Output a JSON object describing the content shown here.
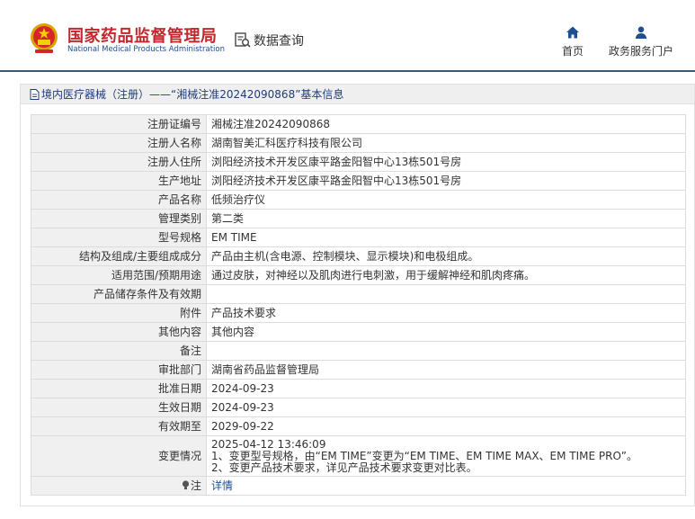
{
  "header": {
    "brand_cn": "国家药品监督管理局",
    "brand_en": "National Medical Products Administration",
    "query_label": "数据查询",
    "nav": [
      {
        "label": "首页"
      },
      {
        "label": "政务服务门户"
      }
    ]
  },
  "panel": {
    "title": "境内医疗器械（注册）——“湘械注准20242090868”基本信息",
    "rows": [
      {
        "key": "注册证编号",
        "value": "湘械注准20242090868"
      },
      {
        "key": "注册人名称",
        "value": "湖南智美汇科医疗科技有限公司"
      },
      {
        "key": "注册人住所",
        "value": "浏阳经济技术开发区康平路金阳智中心13栋501号房"
      },
      {
        "key": "生产地址",
        "value": "浏阳经济技术开发区康平路金阳智中心13栋501号房"
      },
      {
        "key": "产品名称",
        "value": "低频治疗仪"
      },
      {
        "key": "管理类别",
        "value": "第二类"
      },
      {
        "key": "型号规格",
        "value": "EM TIME"
      },
      {
        "key": "结构及组成/主要组成成分",
        "value": "产品由主机(含电源、控制模块、显示模块)和电极组成。"
      },
      {
        "key": "适用范围/预期用途",
        "value": "通过皮肤，对神经以及肌肉进行电刺激，用于缓解神经和肌肉疼痛。"
      },
      {
        "key": "产品储存条件及有效期",
        "value": ""
      },
      {
        "key": "附件",
        "value": "产品技术要求"
      },
      {
        "key": "其他内容",
        "value": "其他内容"
      },
      {
        "key": "备注",
        "value": ""
      },
      {
        "key": "审批部门",
        "value": "湖南省药品监督管理局"
      },
      {
        "key": "批准日期",
        "value": "2024-09-23"
      },
      {
        "key": "生效日期",
        "value": "2024-09-23"
      },
      {
        "key": "有效期至",
        "value": "2029-09-22"
      }
    ],
    "change": {
      "key": "变更情况",
      "lines": [
        "2025-04-12 13:46:09",
        "1、变更型号规格，由“EM TIME”变更为“EM TIME、EM TIME MAX、EM TIME PRO”。",
        "2、变更产品技术要求，详见产品技术要求变更对比表。"
      ]
    },
    "note": {
      "key": "注",
      "link": "详情"
    }
  },
  "colors": {
    "brand_red": "#c0282d",
    "brand_blue": "#1e4f8f",
    "header_rule": "#2c5f86",
    "key_bg": "#f0f0f0"
  }
}
